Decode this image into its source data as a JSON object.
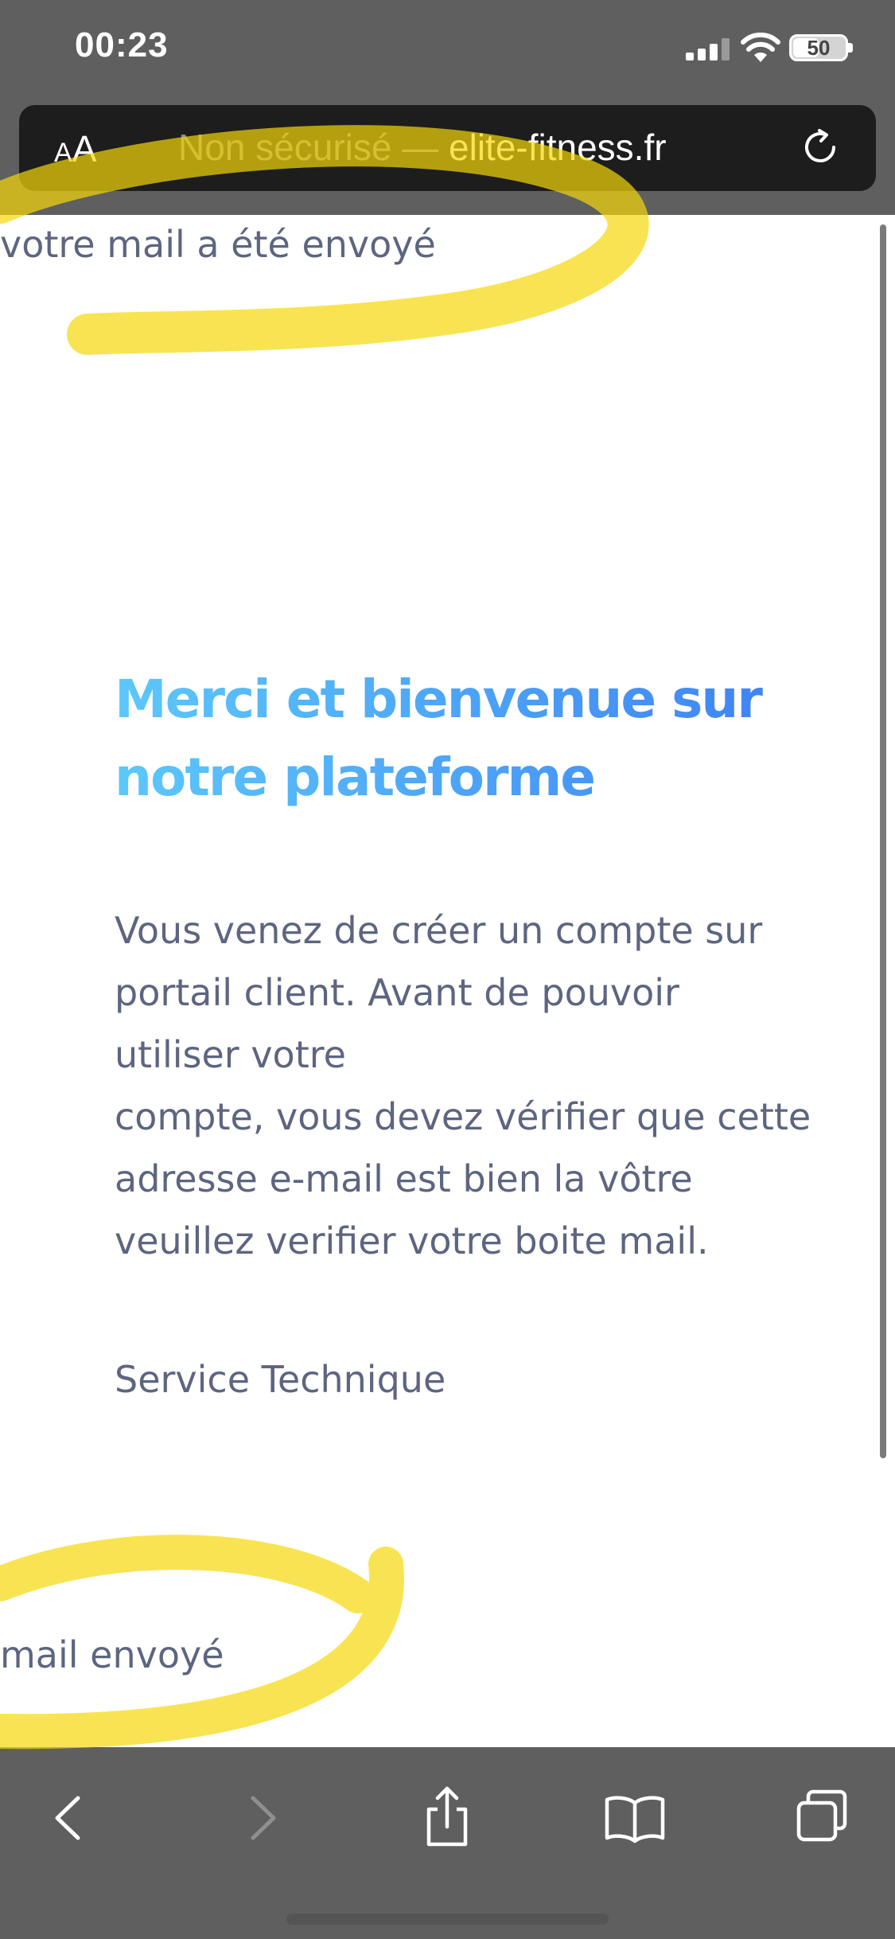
{
  "status_bar": {
    "time": "00:23",
    "battery_level": "50",
    "battery_fraction": 0.5,
    "icons": [
      "signal-icon",
      "wifi-icon",
      "battery-icon"
    ]
  },
  "address_bar": {
    "text_size_button": {
      "small": "A",
      "big": "A"
    },
    "url_prefix": "Non sécurisé — ",
    "url_domain": "elite-fitness.fr",
    "reload_icon": "reload-icon"
  },
  "page": {
    "sent_notice_top": "votre mail a été envoyé",
    "heading_lines": [
      "Merci et bienvenue sur",
      "notre plateforme"
    ],
    "body_lines": [
      "Vous venez de créer un compte sur",
      "portail client. Avant de pouvoir",
      "utiliser votre",
      "compte, vous devez vérifier que cette",
      "adresse e-mail est bien la vôtre",
      "veuillez verifier votre boite mail."
    ],
    "signature": "Service Technique",
    "sent_notice_bottom": "mail envoyé"
  },
  "toolbar": {
    "icons": [
      "back-icon",
      "forward-icon",
      "share-icon",
      "bookmarks-icon",
      "tabs-icon"
    ]
  },
  "colors": {
    "chrome_gray": "#5f5f5f",
    "address_bar": "#1d1d1d",
    "text": "#5d6580",
    "heading_gradient_start": "#5cc8fa",
    "heading_gradient_end": "#3d7ef2",
    "highlighter": "#f5d90a"
  }
}
